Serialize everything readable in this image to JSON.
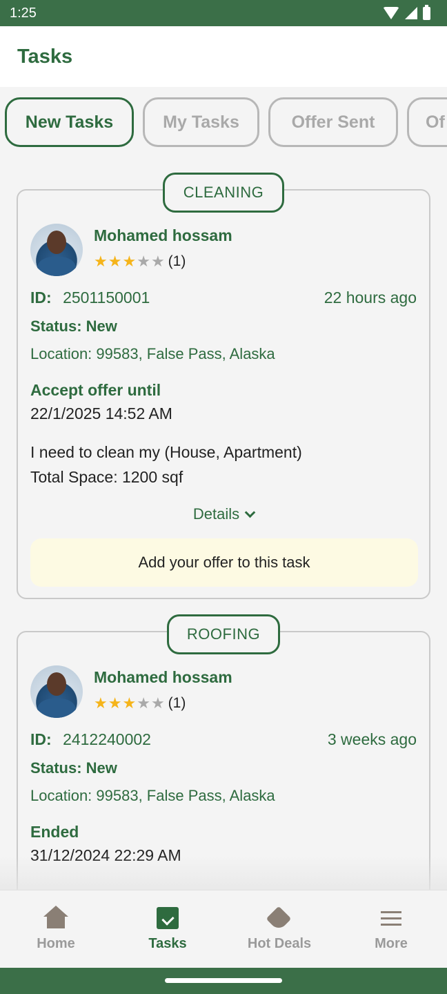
{
  "status_bar": {
    "time": "1:25"
  },
  "header": {
    "title": "Tasks"
  },
  "tabs": [
    {
      "label": "New Tasks"
    },
    {
      "label": "My Tasks"
    },
    {
      "label": "Offer Sent"
    },
    {
      "label": "Of"
    }
  ],
  "tasks": [
    {
      "category": "CLEANING",
      "user_name": "Mohamed hossam",
      "rating_count": "(1)",
      "id_label": "ID:",
      "id": "2501150001",
      "time_ago": "22 hours ago",
      "status": "Status: New",
      "location": "Location: 99583, False Pass,  Alaska",
      "deadline_label": "Accept offer until",
      "deadline": "22/1/2025  14:52 AM",
      "description_1": "I need to clean my (House, Apartment)",
      "description_2": "Total Space: 1200 sqf",
      "details_label": "Details",
      "offer_button": "Add your offer to this task"
    },
    {
      "category": "ROOFING",
      "user_name": "Mohamed hossam",
      "rating_count": "(1)",
      "id_label": "ID:",
      "id": "2412240002",
      "time_ago": "3 weeks ago",
      "status": "Status: New",
      "location": "Location: 99583, False Pass,  Alaska",
      "deadline_label": "Ended",
      "deadline": "31/12/2024  22:29 AM"
    }
  ],
  "bottom_nav": [
    {
      "label": "Home",
      "icon": "home-icon"
    },
    {
      "label": "Tasks",
      "icon": "tasks-icon"
    },
    {
      "label": "Hot Deals",
      "icon": "tag-icon"
    },
    {
      "label": "More",
      "icon": "menu-icon"
    }
  ],
  "colors": {
    "primary": "#2e6b3f",
    "status_bar": "#3b6f48",
    "offer_bg": "#fdfae3",
    "star": "#f5b41a"
  }
}
